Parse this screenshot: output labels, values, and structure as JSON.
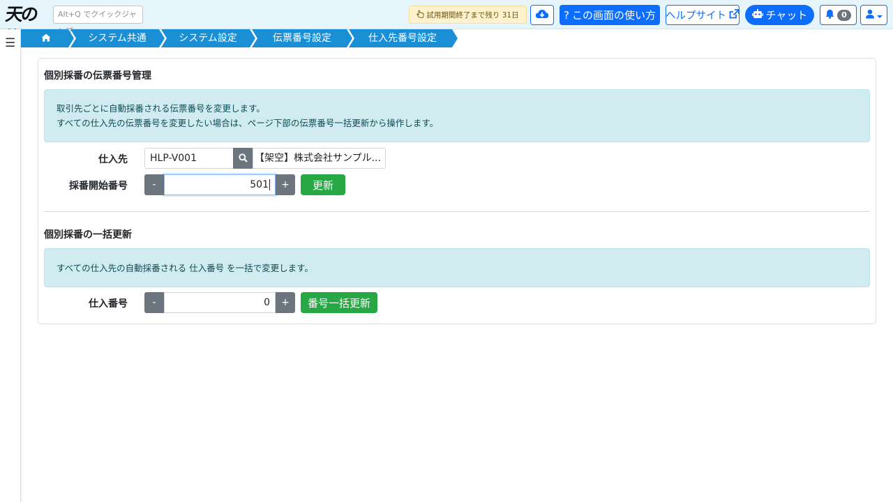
{
  "header": {
    "logo_text": "天の蔵",
    "quick_jump_placeholder": "Alt+Q でクイックジャンプ",
    "trial_text": "試用期間終了まで残り 31日",
    "usage_label": "この画面の使い方",
    "help_label": "ヘルプサイト",
    "chat_label": "チャット",
    "notification_count": "0"
  },
  "breadcrumb": [
    {
      "label": "home",
      "icon": "home-icon"
    },
    {
      "label": "システム共通"
    },
    {
      "label": "システム設定"
    },
    {
      "label": "伝票番号設定"
    },
    {
      "label": "仕入先番号設定"
    }
  ],
  "section1": {
    "title": "個別採番の伝票番号管理",
    "info_line1": "取引先ごとに自動採番される伝票番号を変更します。",
    "info_line2": "すべての仕入先の伝票番号を変更したい場合は、ページ下部の伝票番号一括更新から操作します。",
    "supplier_label": "仕入先",
    "supplier_code": "HLP-V001",
    "supplier_name": "【架空】株式会社サンプル...",
    "start_number_label": "採番開始番号",
    "start_number_value": "501",
    "minus": "-",
    "plus": "+",
    "update_label": "更新"
  },
  "section2": {
    "title": "個別採番の一括更新",
    "info_line1": "すべての仕入先の自動採番される 仕入番号 を一括で変更します。",
    "number_label": "仕入番号",
    "number_value": "0",
    "minus": "-",
    "plus": "+",
    "bulk_update_label": "番号一括更新"
  },
  "colors": {
    "header_bg": "#e6f4fb",
    "primary": "#0d6efd",
    "breadcrumb_bg": "#1a8fd6",
    "info_bg": "#d1ecf1",
    "success": "#28a745",
    "secondary": "#6c757d"
  }
}
